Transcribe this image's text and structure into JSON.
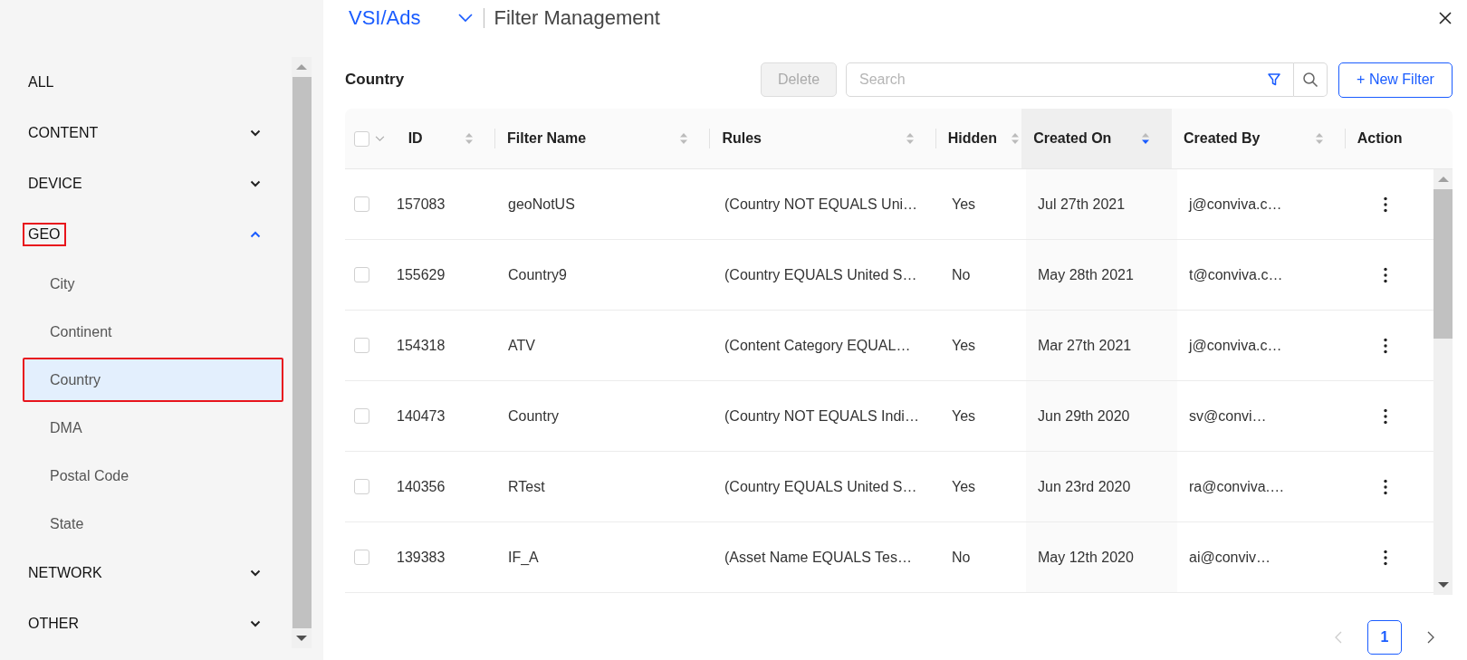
{
  "sidebar": {
    "items": [
      {
        "label": "ALL",
        "kind": "leaf",
        "selected": false,
        "annotated": false
      },
      {
        "label": "CONTENT",
        "kind": "group",
        "expanded": false,
        "annotated": false
      },
      {
        "label": "DEVICE",
        "kind": "group",
        "expanded": false,
        "annotated": false
      },
      {
        "label": "GEO",
        "kind": "group",
        "expanded": true,
        "annotated": true,
        "children": [
          {
            "label": "City",
            "selected": false,
            "annotated": false
          },
          {
            "label": "Continent",
            "selected": false,
            "annotated": false
          },
          {
            "label": "Country",
            "selected": true,
            "annotated": true
          },
          {
            "label": "DMA",
            "selected": false,
            "annotated": false
          },
          {
            "label": "Postal Code",
            "selected": false,
            "annotated": false
          },
          {
            "label": "State",
            "selected": false,
            "annotated": false
          }
        ]
      },
      {
        "label": "NETWORK",
        "kind": "group",
        "expanded": false,
        "annotated": false
      },
      {
        "label": "OTHER",
        "kind": "group",
        "expanded": false,
        "annotated": false
      }
    ]
  },
  "header": {
    "account": "VSI/Ads",
    "title": "Filter Management"
  },
  "toolbar": {
    "heading": "Country",
    "delete_button": {
      "label": "Delete",
      "disabled": true
    },
    "search": {
      "placeholder": "Search"
    },
    "new_button": "+ New Filter"
  },
  "table": {
    "select_all": {
      "checked": false
    },
    "columns": [
      {
        "label": "ID",
        "sortable": true,
        "sorted": false
      },
      {
        "label": "Filter Name",
        "sortable": true,
        "sorted": false
      },
      {
        "label": "Rules",
        "sortable": true,
        "sorted": false
      },
      {
        "label": "Hidden",
        "sortable": true,
        "sorted": false
      },
      {
        "label": "Created On",
        "sortable": true,
        "sorted": true
      },
      {
        "label": "Created By",
        "sortable": true,
        "sorted": false
      },
      {
        "label": "Action",
        "sortable": false,
        "sorted": false
      }
    ],
    "rows": [
      {
        "checked": false,
        "cells": [
          "157083",
          "geoNotUS",
          "(Country NOT EQUALS Uni…",
          "Yes",
          "Jul 27th 2021",
          "j@conviva.c…"
        ]
      },
      {
        "checked": false,
        "cells": [
          "155629",
          "Country9",
          "(Country EQUALS United S…",
          "No",
          "May 28th 2021",
          "t@conviva.c…"
        ]
      },
      {
        "checked": false,
        "cells": [
          "154318",
          "ATV",
          "(Content Category EQUAL…",
          "Yes",
          "Mar 27th 2021",
          "j@conviva.c…"
        ]
      },
      {
        "checked": false,
        "cells": [
          "140473",
          "Country",
          "(Country NOT EQUALS Indi…",
          "Yes",
          "Jun 29th 2020",
          "sv@convi…"
        ]
      },
      {
        "checked": false,
        "cells": [
          "140356",
          "RTest",
          "(Country EQUALS United S…",
          "Yes",
          "Jun 23rd 2020",
          "ra@conviva.…"
        ]
      },
      {
        "checked": false,
        "cells": [
          "139383",
          "IF_A",
          "(Asset Name EQUALS Tes…",
          "No",
          "May 12th 2020",
          "ai@conviv…"
        ]
      }
    ]
  },
  "pagination": {
    "prev_disabled": true,
    "pages": [
      {
        "label": "1",
        "selected": true
      }
    ],
    "next_disabled": false
  }
}
